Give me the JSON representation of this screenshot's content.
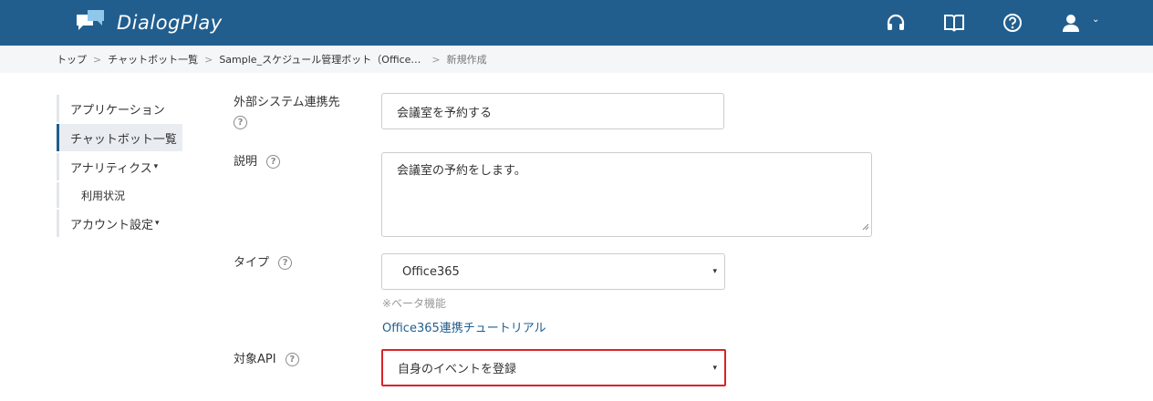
{
  "header": {
    "app_name": "DialogPlay",
    "icons": [
      "headset-icon",
      "book-icon",
      "help-icon",
      "user-icon",
      "chevron-down-icon"
    ]
  },
  "breadcrumb": {
    "items": [
      "トップ",
      "チャットボット一覧",
      "Sample_スケジュール管理ボット（Office…"
    ],
    "separator": ">",
    "current": "新規作成"
  },
  "sidebar": {
    "items": [
      {
        "label": "アプリケーション"
      },
      {
        "label": "チャットボット一覧"
      },
      {
        "label": "アナリティクス",
        "caret": "▾"
      },
      {
        "label": "利用状況"
      },
      {
        "label": "アカウント設定",
        "caret": "▾"
      }
    ]
  },
  "form": {
    "external_system": {
      "label": "外部システム連携先",
      "value": "会議室を予約する"
    },
    "description": {
      "label": "説明",
      "value": "会議室の予約をします。"
    },
    "type": {
      "label": "タイプ",
      "value": "Office365",
      "note": "※ベータ機能",
      "link": "Office365連携チュートリアル"
    },
    "target_api": {
      "label": "対象API",
      "value": "自身のイベントを登録"
    },
    "help_glyph": "?",
    "select_caret": "▾"
  },
  "colors": {
    "header_bg": "#215e8e",
    "breadcrumb_bg": "#f4f6f8",
    "highlight": "#d9232a",
    "link": "#215e8e"
  }
}
